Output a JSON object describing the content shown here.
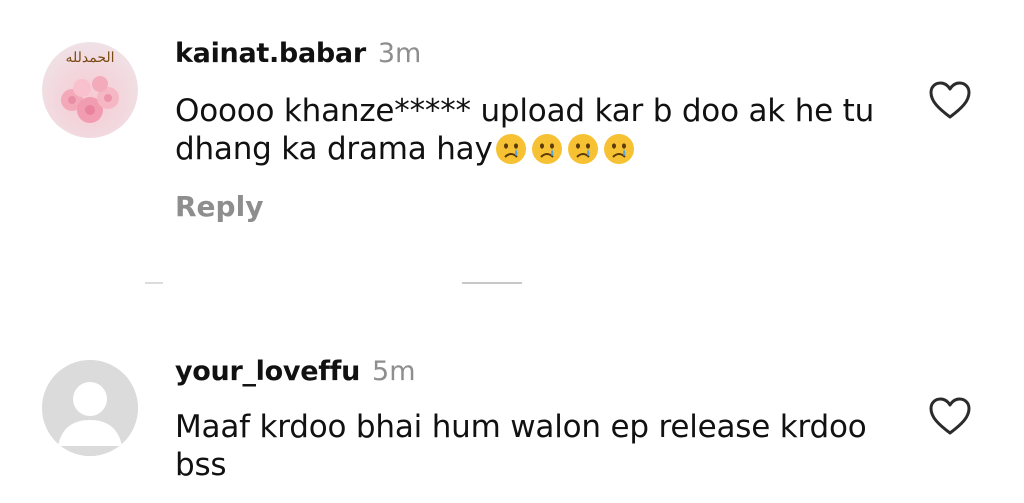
{
  "comments": [
    {
      "username": "kainat.babar",
      "time": "3m",
      "avatar_caption": "الحمدلله",
      "text": "Ooooo khanze***** upload kar b doo ak he tu dhang ka drama hay",
      "emoji": [
        "😢",
        "😢",
        "😢",
        "😢"
      ],
      "reply_label": "Reply"
    },
    {
      "username": "your_loveffu",
      "time": "5m",
      "text": "Maaf krdoo bhai hum walon ep release krdoo bss"
    }
  ],
  "icons": {
    "like": "heart-outline-icon",
    "emoji": "crying-face-emoji",
    "default_avatar": "default-avatar-icon"
  },
  "colors": {
    "text": "#111111",
    "muted": "#8e8e8e",
    "avatar_default_bg": "#dbdbdb",
    "emoji_yellow": "#f6c233",
    "tear_blue": "#56a7e8"
  }
}
